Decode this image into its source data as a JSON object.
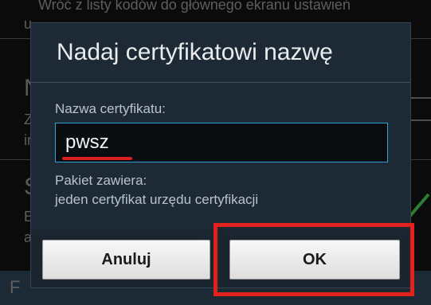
{
  "background": {
    "line1": "Wróć z listy kodów do głównego ekranu ustawień",
    "line2": "u",
    "item1_letter": "N",
    "item1_line1": "Z",
    "item1_line2": "ir",
    "item2_letter": "S",
    "item2_line1": "E",
    "item2_line2": "a",
    "footer_letter": "F"
  },
  "dialog": {
    "title": "Nadaj certyfikatowi nazwę",
    "name_label": "Nazwa certyfikatu:",
    "name_value": "pwsz",
    "package_label": "Pakiet zawiera:",
    "package_content": "jeden certyfikat urzędu certyfikacji",
    "cancel_label": "Anuluj",
    "ok_label": "OK"
  },
  "colors": {
    "accent": "#2fa4d9",
    "highlight": "#e3221d"
  }
}
